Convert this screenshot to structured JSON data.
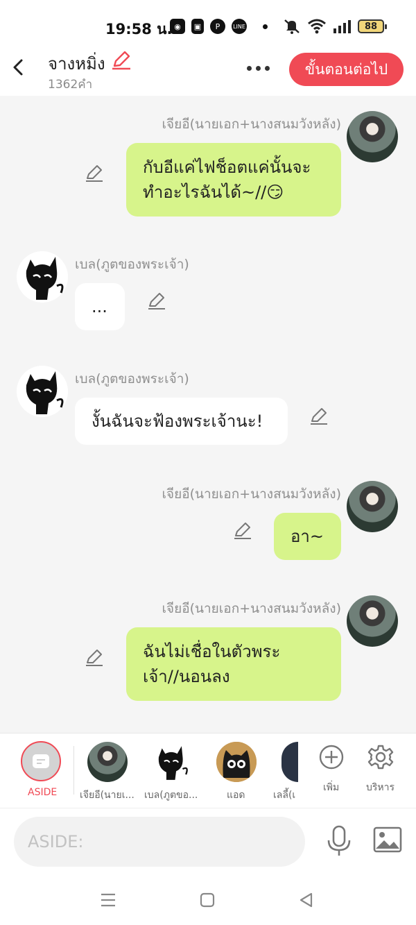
{
  "status": {
    "time": "19:58 น.",
    "battery": "88"
  },
  "header": {
    "title": "จางหมิ่ง",
    "subtitle": "1362คำ",
    "next_label": "ขั้นตอนต่อไป"
  },
  "messages": [
    {
      "side": "right",
      "name": "เจียอี(นายเอก+นางสนมวังหลัง)",
      "lines": [
        "กับอีแค่ไฟช็อตแค่นั้นจะ",
        "ทำอะไรฉันได้~//😏"
      ]
    },
    {
      "side": "left",
      "name": "เบล(ภูตของพระเจ้า)",
      "lines": [
        "..."
      ]
    },
    {
      "side": "left",
      "name": "เบล(ภูตของพระเจ้า)",
      "lines": [
        "งั้นฉันจะฟ้องพระเจ้านะ!"
      ]
    },
    {
      "side": "right",
      "name": "เจียอี(นายเอก+นางสนมวังหลัง)",
      "lines": [
        "อา~"
      ]
    },
    {
      "side": "right",
      "name": "เจียอี(นายเอก+นางสนมวังหลัง)",
      "lines": [
        "ฉันไม่เชื่อในตัวพระ",
        "เจ้า//นอนลง"
      ]
    }
  ],
  "characters": {
    "aside_label": "ASIDE",
    "items": [
      {
        "label": "เจียอี(นายเ..."
      },
      {
        "label": "เบล(ภูตขอ..."
      },
      {
        "label": "แอด"
      },
      {
        "label": "เลลี้(เ"
      }
    ],
    "add_label": "เพิ่ม",
    "manage_label": "บริหาร"
  },
  "input": {
    "placeholder": "ASIDE:"
  },
  "colors": {
    "accent": "#f04a55",
    "bubble_right": "#d7f48b",
    "bubble_left": "#ffffff",
    "background": "#f5f5f5"
  }
}
